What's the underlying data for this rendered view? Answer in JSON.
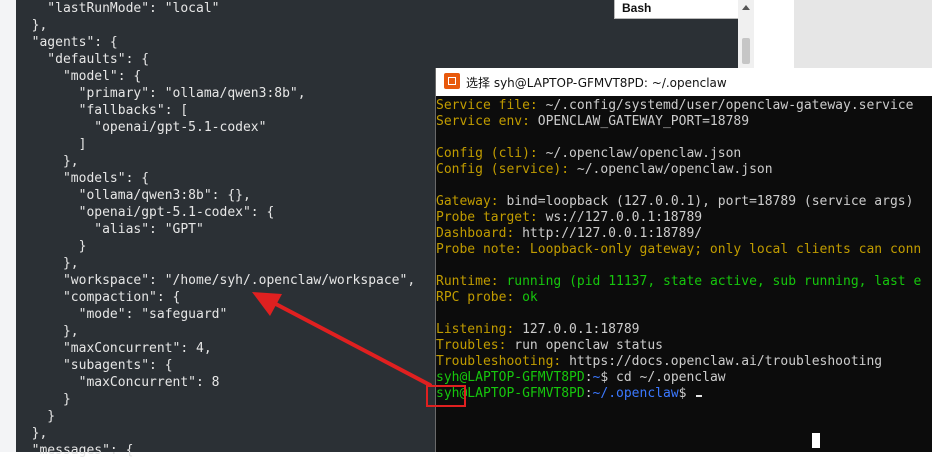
{
  "editor": {
    "lines": [
      "    \"lastRunMode\": \"local\"",
      "  },",
      "  \"agents\": {",
      "    \"defaults\": {",
      "      \"model\": {",
      "        \"primary\": \"ollama/qwen3:8b\",",
      "        \"fallbacks\": [",
      "          \"openai/gpt-5.1-codex\"",
      "        ]",
      "      },",
      "      \"models\": {",
      "        \"ollama/qwen3:8b\": {},",
      "        \"openai/gpt-5.1-codex\": {",
      "          \"alias\": \"GPT\"",
      "        }",
      "      },",
      "      \"workspace\": \"/home/syh/.openclaw/workspace\",",
      "      \"compaction\": {",
      "        \"mode\": \"safeguard\"",
      "      },",
      "      \"maxConcurrent\": 4,",
      "      \"subagents\": {",
      "        \"maxConcurrent\": 8",
      "      }",
      "    }",
      "  },",
      "  \"messages\": {"
    ]
  },
  "dropdown": {
    "label": "Bash"
  },
  "terminal": {
    "title": "选择 syh@LAPTOP-GFMVT8PD: ~/.openclaw",
    "lines": [
      [
        {
          "c": "y",
          "t": "Service file: "
        },
        {
          "c": "w",
          "t": "~/.config/systemd/user/openclaw-gateway.service"
        }
      ],
      [
        {
          "c": "y",
          "t": "Service env: "
        },
        {
          "c": "w",
          "t": "OPENCLAW_GATEWAY_PORT=18789"
        }
      ],
      [],
      [
        {
          "c": "y",
          "t": "Config (cli): "
        },
        {
          "c": "w",
          "t": "~/.openclaw/openclaw.json"
        }
      ],
      [
        {
          "c": "y",
          "t": "Config (service): "
        },
        {
          "c": "w",
          "t": "~/.openclaw/openclaw.json"
        }
      ],
      [],
      [
        {
          "c": "y",
          "t": "Gateway: "
        },
        {
          "c": "w",
          "t": "bind=loopback (127.0.0.1), port=18789 (service args)"
        }
      ],
      [
        {
          "c": "y",
          "t": "Probe target: "
        },
        {
          "c": "w",
          "t": "ws://127.0.0.1:18789"
        }
      ],
      [
        {
          "c": "y",
          "t": "Dashboard: "
        },
        {
          "c": "w",
          "t": "http://127.0.0.1:18789/"
        }
      ],
      [
        {
          "c": "y",
          "t": "Probe note: "
        },
        {
          "c": "y",
          "t": "Loopback-only gateway; only local clients can conn"
        }
      ],
      [],
      [
        {
          "c": "y",
          "t": "Runtime: "
        },
        {
          "c": "g",
          "t": "running (pid 11137, state active, sub running, last e"
        }
      ],
      [
        {
          "c": "y",
          "t": "RPC probe: "
        },
        {
          "c": "g",
          "t": "ok"
        }
      ],
      [],
      [
        {
          "c": "y",
          "t": "Listening: "
        },
        {
          "c": "w",
          "t": "127.0.0.1:18789"
        }
      ],
      [
        {
          "c": "y",
          "t": "Troubles: "
        },
        {
          "c": "w",
          "t": "run openclaw status"
        }
      ],
      [
        {
          "c": "y",
          "t": "Troubleshooting: "
        },
        {
          "c": "w",
          "t": "https://docs.openclaw.ai/troubleshooting"
        }
      ],
      [
        {
          "c": "g",
          "t": "syh@LAPTOP-GFMVT8PD"
        },
        {
          "c": "w",
          "t": ":"
        },
        {
          "c": "b",
          "t": "~"
        },
        {
          "c": "w",
          "t": "$ cd ~/.openclaw"
        }
      ],
      [
        {
          "c": "g",
          "t": "syh@LAPTOP-GFMVT8PD"
        },
        {
          "c": "w",
          "t": ":"
        },
        {
          "c": "b",
          "t": "~/.openclaw"
        },
        {
          "c": "w",
          "t": "$ "
        }
      ]
    ]
  },
  "colors": {
    "editor_bg": "#2b3035",
    "terminal_bg": "#0c0c0c",
    "annotation_red": "#e02020",
    "prompt_green": "#16c60c",
    "label_yellow": "#c19c00",
    "path_blue": "#3b78ff"
  }
}
